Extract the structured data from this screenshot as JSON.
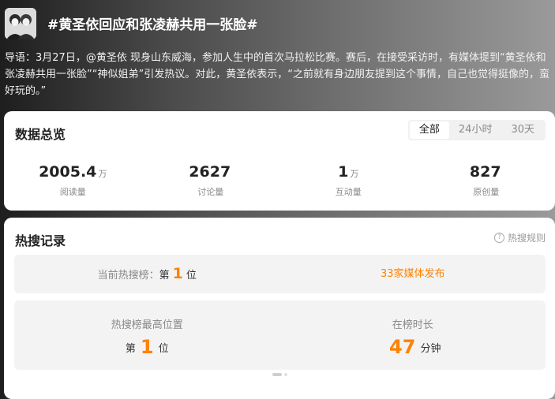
{
  "topic": {
    "title": "#黄圣依回应和张凌赫共用一张脸#",
    "intro": "导语：3月27日，@黄圣依 现身山东威海，参加人生中的首次马拉松比赛。赛后，在接受采访时，有媒体提到“黄圣依和张凌赫共用一张脸”“神似姐弟”引发热议。对此，黄圣依表示，“之前就有身边朋友提到这个事情，自己也觉得挺像的，蛮好玩的。”",
    "avatar_icon": "portrait-photo"
  },
  "overview": {
    "title": "数据总览",
    "tabs": [
      {
        "label": "全部",
        "active": true
      },
      {
        "label": "24小时",
        "active": false
      },
      {
        "label": "30天",
        "active": false
      }
    ],
    "stats": [
      {
        "value": "2005.4",
        "unit": "万",
        "label": "阅读量"
      },
      {
        "value": "2627",
        "unit": "",
        "label": "讨论量"
      },
      {
        "value": "1",
        "unit": "万",
        "label": "互动量"
      },
      {
        "value": "827",
        "unit": "",
        "label": "原创量"
      }
    ]
  },
  "hot": {
    "title": "热搜记录",
    "rules_label": "热搜规则",
    "rules_icon": "question-circle-icon",
    "current": {
      "prefix": "当前热搜榜：",
      "di": "第",
      "rank": "1",
      "wei": "位",
      "media_link": "33家媒体发布"
    },
    "highest": {
      "label": "热搜榜最高位置",
      "di": "第",
      "rank": "1",
      "wei": "位"
    },
    "duration": {
      "label": "在榜时长",
      "value": "47",
      "unit": "分钟"
    }
  },
  "colors": {
    "accent": "#ff8200",
    "card_bg": "#ffffff",
    "panel_bg": "#f3f3f3"
  }
}
